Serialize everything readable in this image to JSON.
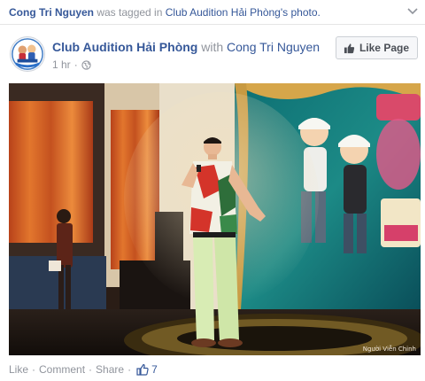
{
  "story": {
    "actor": "Cong Tri Nguyen",
    "verb": "was tagged in",
    "page_possessive": "Club Audition Hải Phòng's",
    "object": "photo."
  },
  "post": {
    "page_name": "Club Audition Hải Phòng",
    "with_text": "with",
    "tagged_person": "Cong Tri Nguyen",
    "time": "1 hr",
    "time_sep": "·",
    "like_page_label": "Like Page"
  },
  "photo": {
    "credit": "Người Viễn Chinh"
  },
  "actions": {
    "like": "Like",
    "comment": "Comment",
    "share": "Share",
    "sep": "·",
    "like_count": "7"
  },
  "icons": {
    "menu": "chevron-down-icon",
    "privacy": "globe-icon",
    "like_page": "thumbs-up-icon",
    "like_count": "thumbs-up-outline-icon"
  },
  "colors": {
    "link": "#365899",
    "meta": "#90949c"
  }
}
